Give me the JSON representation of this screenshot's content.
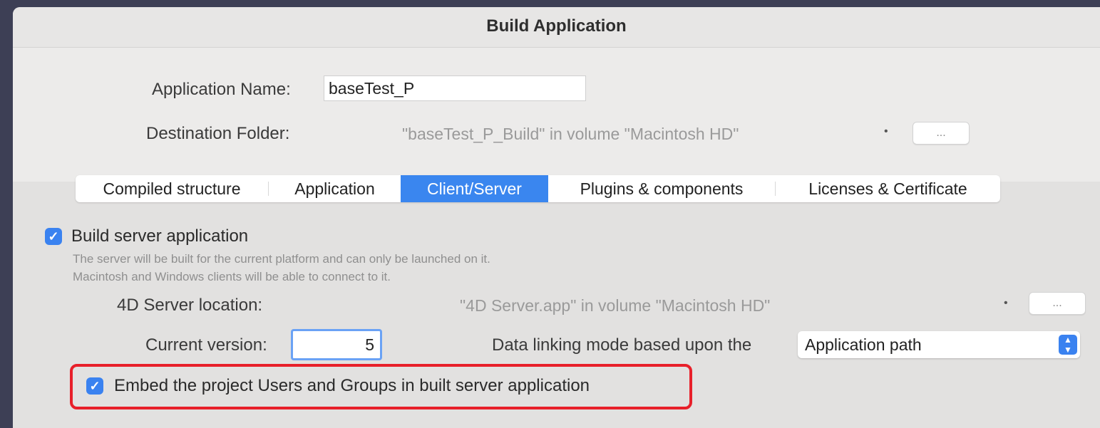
{
  "window": {
    "title": "Build Application"
  },
  "app_name": {
    "label": "Application Name:",
    "value": "baseTest_P"
  },
  "destination": {
    "label": "Destination Folder:",
    "path": "\"baseTest_P_Build\" in volume \"Macintosh HD\"",
    "browse_label": "..."
  },
  "tabs": [
    {
      "label": "Compiled structure"
    },
    {
      "label": "Application"
    },
    {
      "label": "Client/Server"
    },
    {
      "label": "Plugins & components"
    },
    {
      "label": "Licenses & Certificate"
    }
  ],
  "client_server": {
    "build_server": {
      "label": "Build server application",
      "checked": true,
      "desc_line1": "The server will be built for the current platform and can only be launched on it.",
      "desc_line2": "Macintosh and Windows clients will be able to connect to it."
    },
    "server_location": {
      "label": "4D Server location:",
      "path": "\"4D Server.app\" in volume \"Macintosh HD\"",
      "browse_label": "..."
    },
    "current_version": {
      "label": "Current version:",
      "value": "5"
    },
    "data_linking": {
      "label": "Data linking mode based upon the",
      "selected": "Application path"
    },
    "embed_users": {
      "label": "Embed the project Users and Groups in built server application",
      "checked": true
    }
  },
  "colors": {
    "accent": "#3a82f0",
    "highlight": "#e8202a",
    "background": "#3d3f55"
  }
}
